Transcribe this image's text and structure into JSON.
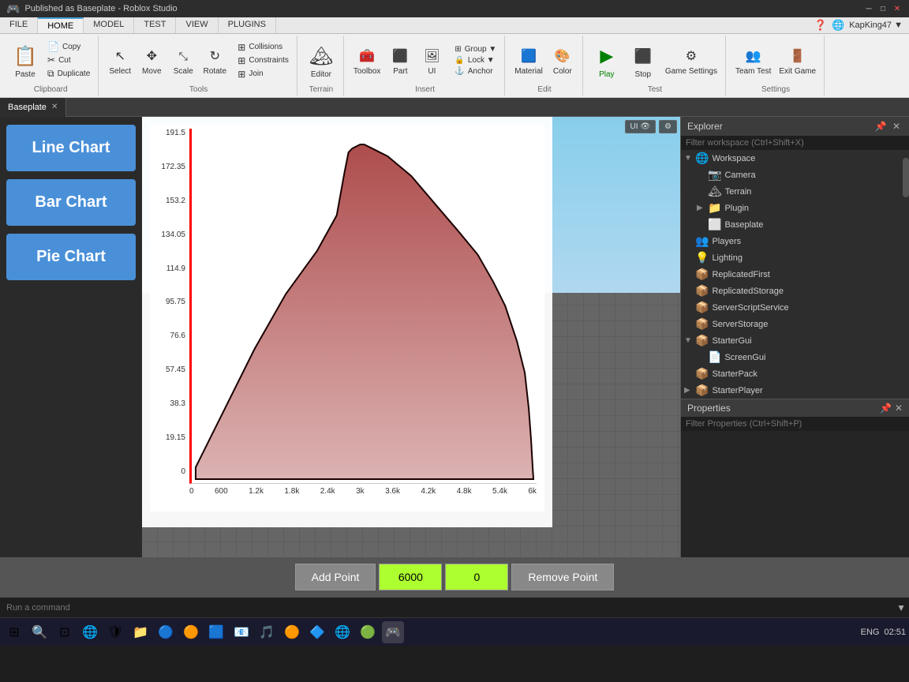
{
  "titleBar": {
    "title": "Published as Baseplate - Roblox Studio",
    "controls": [
      "─",
      "□",
      "✕"
    ]
  },
  "ribbon": {
    "tabs": [
      "FILE",
      "HOME",
      "MODEL",
      "TEST",
      "VIEW",
      "PLUGINS"
    ],
    "activeTab": "HOME",
    "groups": {
      "clipboard": {
        "label": "Clipboard",
        "buttons": [
          {
            "label": "Paste",
            "icon": "📋"
          },
          {
            "label": "Copy",
            "icon": ""
          },
          {
            "label": "Cut",
            "icon": ""
          },
          {
            "label": "Duplicate",
            "icon": ""
          }
        ]
      },
      "tools": {
        "label": "Tools",
        "buttons": [
          {
            "label": "Select",
            "icon": "↖"
          },
          {
            "label": "Move",
            "icon": "✥"
          },
          {
            "label": "Scale",
            "icon": "⤡"
          },
          {
            "label": "Rotate",
            "icon": "↻"
          }
        ],
        "small": [
          {
            "label": "Collisions",
            "icon": "☰"
          },
          {
            "label": "Constraints",
            "icon": "☰"
          },
          {
            "label": "Join",
            "icon": "☰"
          }
        ]
      },
      "terrain": {
        "label": "Terrain",
        "buttons": [
          {
            "label": "Editor",
            "icon": "🏔"
          }
        ]
      },
      "insert": {
        "label": "Insert",
        "buttons": [
          {
            "label": "Toolbox",
            "icon": "🧰"
          },
          {
            "label": "Part",
            "icon": "⬛"
          },
          {
            "label": "UI",
            "icon": "🖼"
          }
        ],
        "small": [
          {
            "label": "Group",
            "icon": ""
          },
          {
            "label": "Lock",
            "icon": ""
          },
          {
            "label": "Anchor",
            "icon": ""
          }
        ]
      },
      "edit": {
        "label": "Edit",
        "buttons": [
          {
            "label": "Material",
            "icon": "🟦"
          },
          {
            "label": "Color",
            "icon": "🎨"
          }
        ]
      },
      "test": {
        "label": "Test",
        "buttons": [
          {
            "label": "Play",
            "icon": "▶"
          },
          {
            "label": "Stop",
            "icon": "⏹"
          },
          {
            "label": "Game Settings",
            "icon": "⚙"
          }
        ]
      },
      "settings": {
        "label": "Settings",
        "buttons": [
          {
            "label": "Team Test",
            "icon": "👥"
          },
          {
            "label": "Exit Game",
            "icon": "🚪"
          }
        ]
      }
    }
  },
  "editorTab": {
    "name": "Baseplate",
    "closeable": true
  },
  "leftPanel": {
    "buttons": [
      {
        "label": "Line Chart",
        "id": "line-chart"
      },
      {
        "label": "Bar Chart",
        "id": "bar-chart"
      },
      {
        "label": "Pie Chart",
        "id": "pie-chart"
      }
    ]
  },
  "chart": {
    "yLabels": [
      "191.5",
      "172.35",
      "153.2",
      "134.05",
      "114.9",
      "95.75",
      "76.6",
      "57.45",
      "38.3",
      "19.15",
      "0"
    ],
    "xLabels": [
      "0",
      "600",
      "1.2k",
      "1.8k",
      "2.4k",
      "3k",
      "3.6k",
      "4.2k",
      "4.8k",
      "5.4k",
      "6k"
    ]
  },
  "bottomControls": {
    "addPoint": "Add Point",
    "value1": "6000",
    "value2": "0",
    "removePoint": "Remove Point"
  },
  "viewportToolbar": {
    "uiToggle": "UI 👁",
    "settingsBtn": "⚙"
  },
  "explorer": {
    "title": "Explorer",
    "filterPlaceholder": "Filter workspace (Ctrl+Shift+X)",
    "tree": [
      {
        "label": "Workspace",
        "icon": "🌐",
        "expanded": true,
        "children": [
          {
            "label": "Camera",
            "icon": "📷",
            "children": []
          },
          {
            "label": "Terrain",
            "icon": "🏔",
            "children": []
          },
          {
            "label": "Plugin",
            "icon": "📁",
            "expanded": false,
            "children": []
          },
          {
            "label": "Baseplate",
            "icon": "⬜",
            "children": []
          }
        ]
      },
      {
        "label": "Players",
        "icon": "👥",
        "children": []
      },
      {
        "label": "Lighting",
        "icon": "💡",
        "children": []
      },
      {
        "label": "ReplicatedFirst",
        "icon": "📦",
        "children": []
      },
      {
        "label": "ReplicatedStorage",
        "icon": "📦",
        "children": []
      },
      {
        "label": "ServerScriptService",
        "icon": "📦",
        "children": []
      },
      {
        "label": "ServerStorage",
        "icon": "📦",
        "children": []
      },
      {
        "label": "StarterGui",
        "icon": "📦",
        "expanded": true,
        "children": [
          {
            "label": "ScreenGui",
            "icon": "📄",
            "children": []
          }
        ]
      },
      {
        "label": "StarterPack",
        "icon": "📦",
        "children": []
      },
      {
        "label": "StarterPlayer",
        "icon": "📦",
        "children": []
      }
    ]
  },
  "properties": {
    "title": "Properties",
    "filterPlaceholder": "Filter Properties (Ctrl+Shift+P)"
  },
  "commandBar": {
    "placeholder": "Run a command"
  },
  "taskbar": {
    "icons": [
      "⊞",
      "⊡",
      "🌐",
      "🛡",
      "📁",
      "🔵",
      "🟠",
      "🟦",
      "📧",
      "🎵",
      "🟠",
      "🔷",
      "🌐",
      "🟢"
    ],
    "systemTray": {
      "lang": "ENG",
      "time": "02:51"
    }
  }
}
